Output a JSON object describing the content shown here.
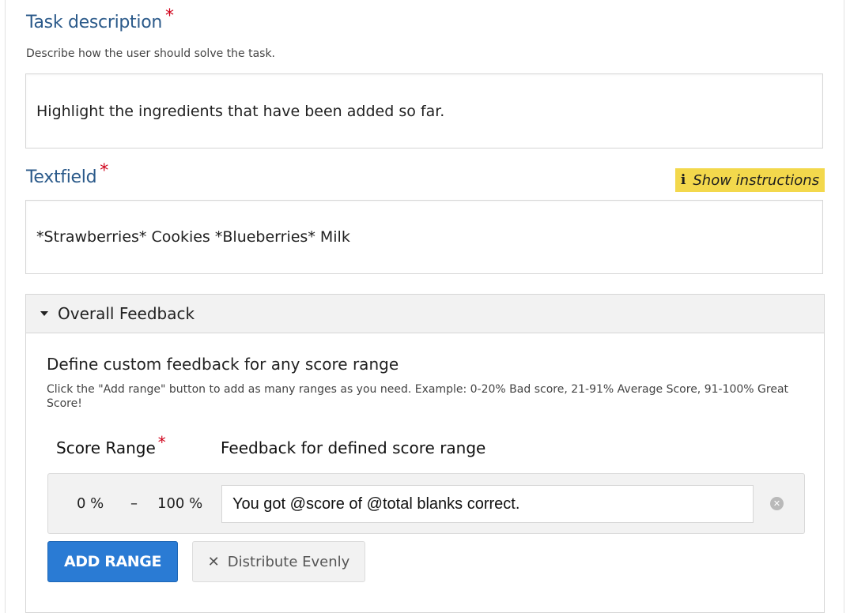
{
  "task_description": {
    "label": "Task description",
    "required_mark": "*",
    "help": "Describe how the user should solve the task.",
    "value": "Highlight the ingredients that have been added so far."
  },
  "textfield": {
    "label": "Textfield",
    "required_mark": "*",
    "instructions_label": "Show instructions",
    "value": "*Strawberries* Cookies *Blueberries* Milk"
  },
  "overall_feedback": {
    "header": "Overall Feedback",
    "title": "Define custom feedback for any score range",
    "description": "Click the \"Add range\" button to add as many ranges as you need. Example: 0-20% Bad score, 21-91% Average Score, 91-100% Great Score!",
    "score_range_header": "Score Range",
    "required_mark": "*",
    "feedback_header": "Feedback for defined score range",
    "ranges": [
      {
        "from": "0 %",
        "separator": "–",
        "to": "100 %",
        "feedback": "You got @score of @total blanks correct."
      }
    ],
    "add_range_label": "ADD RANGE",
    "distribute_label": "Distribute Evenly"
  },
  "colors": {
    "label_blue": "#2b5a8a",
    "required_red": "#d0021b",
    "instructions_yellow": "#f3d84c",
    "primary_button": "#2a7bd4"
  }
}
